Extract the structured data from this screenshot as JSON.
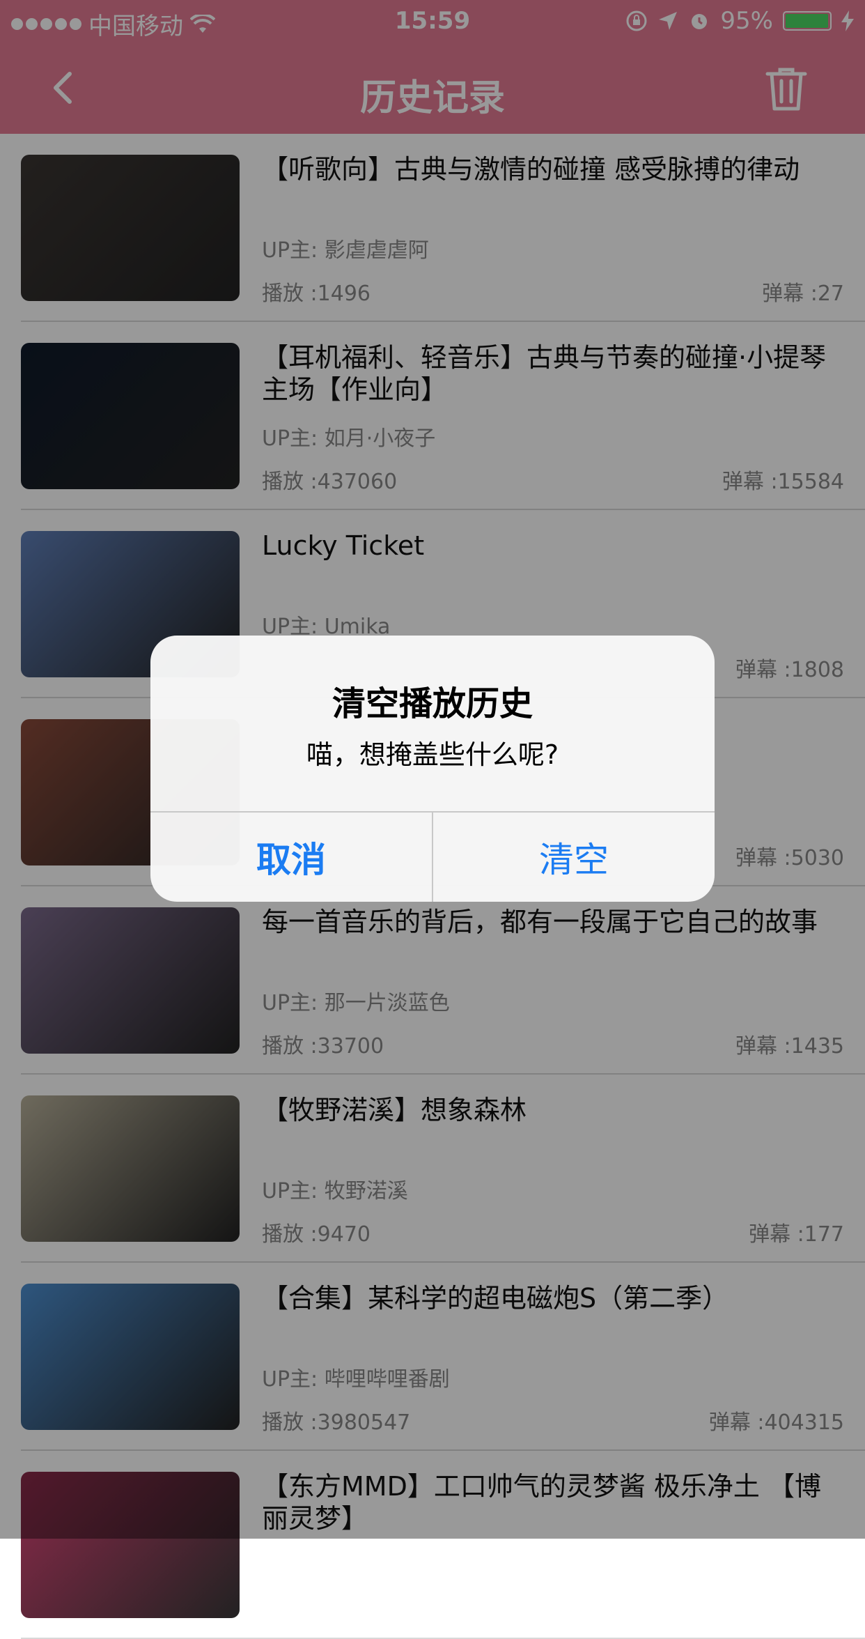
{
  "status_bar": {
    "carrier": "中国移动",
    "time": "15:59",
    "battery": "95%",
    "battery_level": 0.95
  },
  "nav": {
    "title": "历史记录",
    "back_icon": "chevron-left-icon",
    "delete_icon": "trash-icon"
  },
  "history": [
    {
      "title": "【听歌向】古典与激情的碰撞 感受脉搏的律动",
      "uploader": "UP主: 影虐虐虐阿",
      "plays": "播放 :1496",
      "danmaku": "弹幕 :27",
      "thumb_color": "#3a3532"
    },
    {
      "title": "【耳机福利、轻音乐】古典与节奏的碰撞·小提琴主场【作业向】",
      "uploader": "UP主: 如月·小夜子",
      "plays": "播放 :437060",
      "danmaku": "弹幕 :15584",
      "thumb_color": "#0f1a2a"
    },
    {
      "title": "Lucky Ticket",
      "uploader": "UP主: Umika",
      "plays": "",
      "danmaku": "弹幕 :1808",
      "thumb_color": "#5f7fb8"
    },
    {
      "title": "",
      "uploader": "",
      "plays": "",
      "danmaku": "弹幕 :5030",
      "thumb_color": "#8a4a3a"
    },
    {
      "title": "每一首音乐的背后，都有一段属于它自己的故事",
      "uploader": "UP主: 那一片淡蓝色",
      "plays": "播放 :33700",
      "danmaku": "弹幕 :1435",
      "thumb_color": "#7c6a8c"
    },
    {
      "title": "【牧野渃溪】想象森林",
      "uploader": "UP主: 牧野渃溪",
      "plays": "播放 :9470",
      "danmaku": "弹幕 :177",
      "thumb_color": "#b7b09a"
    },
    {
      "title": "【合集】某科学的超电磁炮S（第二季）",
      "uploader": "UP主: 哔哩哔哩番剧",
      "plays": "播放 :3980547",
      "danmaku": "弹幕 :404315",
      "thumb_color": "#4d8fd1"
    },
    {
      "title": "【东方MMD】工口帅气的灵梦酱  极乐净土  【博丽灵梦】",
      "uploader": "",
      "plays": "",
      "danmaku": "",
      "thumb_color": "#8a2a4a"
    }
  ],
  "alert": {
    "title": "清空播放历史",
    "message": "喵，想掩盖些什么呢?",
    "cancel_label": "取消",
    "confirm_label": "清空",
    "button_color": "#1b7cf2"
  },
  "colors": {
    "nav_bg": "#e37a93",
    "overlay": "rgba(0,0,0,0.4)"
  }
}
